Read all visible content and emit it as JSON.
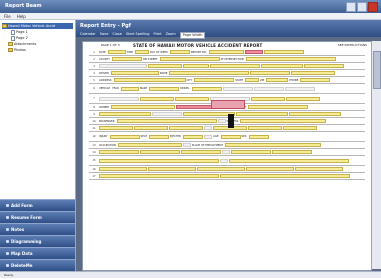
{
  "app": {
    "title": "Report Beam"
  },
  "menu": [
    "File",
    "Help"
  ],
  "tree": {
    "root": "Hawaii Motor Vehicle Accid",
    "pages": [
      "Page 1",
      "Page 2"
    ],
    "others": [
      "Attachments",
      "Photos"
    ]
  },
  "nav_buttons": [
    {
      "label": "Add Form"
    },
    {
      "label": "Resume Form"
    },
    {
      "label": "Notes"
    },
    {
      "label": "Diagramming"
    },
    {
      "label": "Map Data"
    },
    {
      "label": "DeleteMe"
    }
  ],
  "main": {
    "title": "Report Entry - Pgf",
    "toolbar": {
      "items": [
        "Calendar",
        "Save",
        "Close",
        "Start Spelling",
        "Print"
      ],
      "zoom_label": "Zoom",
      "zoom_value": "Page Width"
    }
  },
  "form": {
    "header": "STATE OF HAWAII    MOTOR VEHICLE ACCIDENT REPORT",
    "left_note": "PAGE 1 OF 3",
    "right_note": "SEE INSTRUCTIONS",
    "labels": [
      "DATE",
      "TIME",
      "DAY OF WEEK",
      "REPORT NO.",
      "COUNTY",
      "ON STREET",
      "AT INTERSECTION",
      "DRIVER",
      "NAME",
      "ADDRESS",
      "CITY",
      "STATE",
      "ZIP",
      "PHONE",
      "VEHICLE",
      "YEAR",
      "MAKE",
      "MODEL",
      "OWNER",
      "INSURANCE",
      "PASSENGER",
      "WITNESS",
      "INJURY",
      "SEAT",
      "EJECTED",
      "AGE",
      "SEX",
      "OCCUPATION",
      "PLACE OF EMPLOYMENT"
    ]
  },
  "status": {
    "text": "Ready"
  },
  "colors": {
    "field_yellow": "#f7ec96",
    "field_red": "#f08a9d",
    "header_blue": "#3f5f94"
  }
}
